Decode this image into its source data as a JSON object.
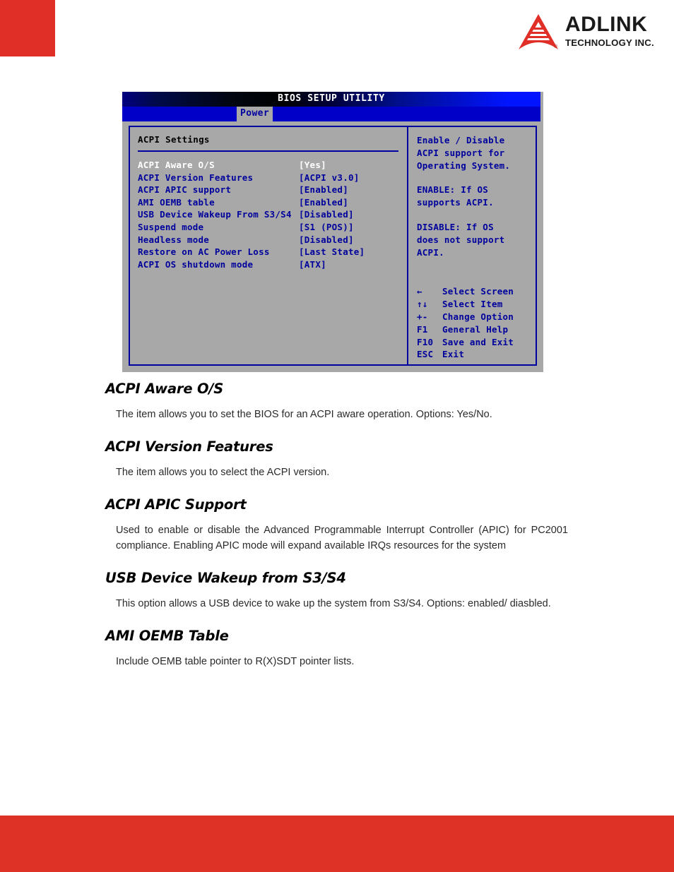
{
  "brand": {
    "logo_word": "ADLINK",
    "logo_sub": "TECHNOLOGY INC.",
    "logo_reg": "®",
    "accent_red": "#de3226"
  },
  "bios": {
    "title": "BIOS SETUP UTILITY",
    "tab": "Power",
    "section_heading": "ACPI Settings",
    "options": [
      {
        "label": "ACPI Aware O/S",
        "value": "[Yes]",
        "selected": true
      },
      {
        "label": "ACPI Version Features",
        "value": "[ACPI v3.0]",
        "selected": false
      },
      {
        "label": "ACPI APIC support",
        "value": "[Enabled]",
        "selected": false
      },
      {
        "label": "AMI OEMB table",
        "value": "[Enabled]",
        "selected": false
      },
      {
        "label": "USB Device Wakeup From S3/S4",
        "value": "[Disabled]",
        "selected": false
      },
      {
        "label": "Suspend mode",
        "value": "[S1 (POS)]",
        "selected": false
      },
      {
        "label": "Headless mode",
        "value": "[Disabled]",
        "selected": false
      },
      {
        "label": "Restore on AC Power Loss",
        "value": "[Last State]",
        "selected": false
      },
      {
        "label": "ACPI OS shutdown mode",
        "value": "[ATX]",
        "selected": false
      }
    ],
    "help": {
      "para1_line1": "Enable / Disable",
      "para1_line2": "ACPI support for",
      "para1_line3": "Operating System.",
      "para2_line1": "ENABLE: If OS",
      "para2_line2": "supports ACPI.",
      "para3_line1": "DISABLE: If OS",
      "para3_line2": "does not support",
      "para3_line3": "ACPI."
    },
    "keys": [
      {
        "key": "←",
        "desc": "Select Screen"
      },
      {
        "key": "↑↓",
        "desc": "Select Item"
      },
      {
        "key": "+-",
        "desc": "Change Option"
      },
      {
        "key": "F1",
        "desc": "General Help"
      },
      {
        "key": "F10",
        "desc": "Save and Exit"
      },
      {
        "key": "ESC",
        "desc": "Exit"
      }
    ],
    "colors": {
      "panel_bg": "#a8a8a8",
      "text_blue": "#00009c",
      "border_blue": "#0000a0",
      "tabbar_blue": "#0000c8"
    }
  },
  "doc": {
    "sections": [
      {
        "title": "ACPI Aware O/S",
        "body": "The item allows you to set the BIOS for an ACPI aware operation. Options: Yes/No."
      },
      {
        "title": "ACPI Version Features",
        "body": "The item allows you to select the ACPI version."
      },
      {
        "title": "ACPI APIC Support",
        "body": "Used to enable or disable the Advanced Programmable Interrupt Controller (APIC) for PC2001 compliance. Enabling APIC mode will expand available IRQs resources for the system"
      },
      {
        "title": "USB Device Wakeup from S3/S4",
        "body": "This option allows a USB device to wake up the system from S3/S4. Options: enabled/ diasbled."
      },
      {
        "title": "AMI OEMB Table",
        "body": "Include OEMB table pointer to R(X)SDT pointer lists."
      }
    ]
  }
}
